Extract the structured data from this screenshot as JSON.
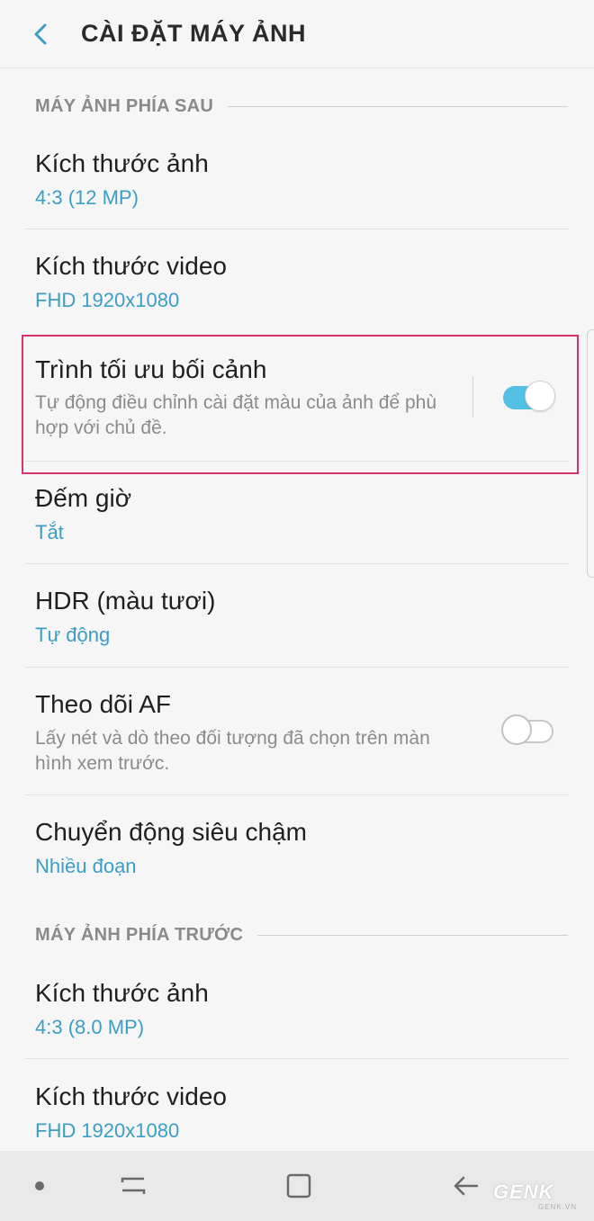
{
  "header": {
    "title": "CÀI ĐẶT MÁY ẢNH",
    "back_icon": "chevron-left-icon",
    "accent": "#3c9ec5"
  },
  "sections": [
    {
      "label": "MÁY ẢNH PHÍA SAU",
      "items": [
        {
          "title": "Kích thước ảnh",
          "value": "4:3 (12 MP)"
        },
        {
          "title": "Kích thước video",
          "value": "FHD 1920x1080"
        },
        {
          "title": "Trình tối ưu bối cảnh",
          "description": "Tự động điều chỉnh cài đặt màu của ảnh để phù hợp với chủ đề.",
          "toggle": true
        },
        {
          "title": "Đếm giờ",
          "value": "Tắt"
        },
        {
          "title": "HDR (màu tươi)",
          "value": "Tự động"
        },
        {
          "title": "Theo dõi AF",
          "description": "Lấy nét và dò theo đối tượng đã chọn trên màn hình xem trước.",
          "toggle": false
        },
        {
          "title": "Chuyển động siêu chậm",
          "value": "Nhiều đoạn"
        }
      ]
    },
    {
      "label": "MÁY ẢNH PHÍA TRƯỚC",
      "items": [
        {
          "title": "Kích thước ảnh",
          "value": "4:3 (8.0 MP)"
        },
        {
          "title": "Kích thước video",
          "value": "FHD 1920x1080"
        }
      ]
    }
  ],
  "navbar": {
    "icons": [
      "dot-icon",
      "recent-apps-icon",
      "home-icon",
      "back-arrow-icon"
    ]
  },
  "watermark": {
    "text": "GENK",
    "subtext": "GENK.VN"
  },
  "colors": {
    "value_text": "#3c9ec5",
    "toggle_on": "#54c0e6",
    "highlight_border": "#d9306f"
  }
}
